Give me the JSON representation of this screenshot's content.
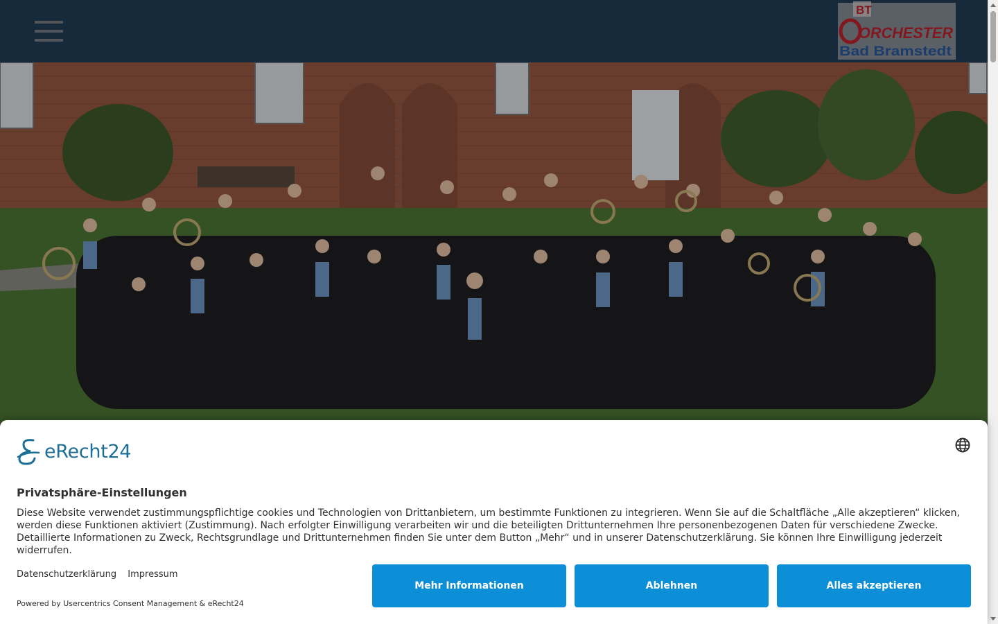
{
  "header": {
    "menu_label": "",
    "logo": {
      "line1": "BT",
      "line2": "ORCHESTER",
      "line3": "Bad Bramstedt"
    }
  },
  "hero": {
    "image_alt": ""
  },
  "consent": {
    "brand": "eRecht24",
    "title": "Privatsphäre-Einstellungen",
    "description": "Diese Website verwendet zustimmungspflichtige cookies und Technologien von Drittanbietern, um bestimmte Funktionen zu integrieren. Wenn Sie auf die Schaltfläche „Alle akzeptieren“ klicken, werden diese Funktionen aktiviert (Zustimmung). Nach erfolgter Einwilligung verarbeiten wir und die beteiligten Drittunternehmen Ihre personenbezogenen Daten für verschiedene Zwecke. Detaillierte Informationen zu Zweck, Rechtsgrundlage und Drittunternehmen finden Sie unter dem Button „Mehr“ und in unserer Datenschutzerklärung. Sie können Ihre Einwilligung jederzeit widerrufen.",
    "links": {
      "privacy": "Datenschutzerklärung",
      "imprint": "Impressum"
    },
    "powered_by": "Powered by Usercentrics Consent Management & eRecht24",
    "buttons": {
      "more": "Mehr Informationen",
      "deny": "Ablehnen",
      "accept": "Alles akzeptieren"
    }
  },
  "colors": {
    "header_bg": "#233e57",
    "button_bg": "#0d8fd8",
    "brand_blue": "#1d6f96",
    "logo_red": "#c0222b"
  },
  "icons": [
    "hamburger-menu-icon",
    "globe-icon",
    "erecht24-logo-icon"
  ]
}
